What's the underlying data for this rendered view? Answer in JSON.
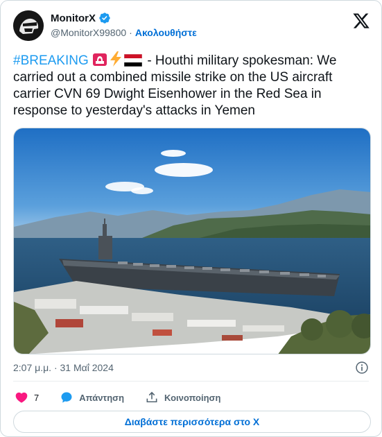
{
  "header": {
    "display_name": "MonitorX",
    "handle": "@MonitorX99800",
    "separator": "·",
    "follow_label": "Ακολουθήστε"
  },
  "tweet": {
    "hashtag": "#BREAKING",
    "text": " - Houthi military spokesman: We carried out a combined missile strike on the US aircraft carrier CVN 69 Dwight Eisenhower in the Red Sea in response to yesterday's attacks in Yemen",
    "emojis": [
      "rotating-light-icon",
      "lightning-icon",
      "yemen-flag-icon"
    ]
  },
  "meta": {
    "timestamp": "2:07 μ.μ. · 31 Μαΐ 2024"
  },
  "actions": {
    "likes": "7",
    "reply_label": "Απάντηση",
    "share_label": "Κοινοποίηση"
  },
  "read_more_label": "Διαβάστε περισσότερα στο X",
  "colors": {
    "link": "#006fd6",
    "hashtag": "#1d9bf0",
    "like": "#f91880",
    "verified": "#1d9bf0"
  }
}
